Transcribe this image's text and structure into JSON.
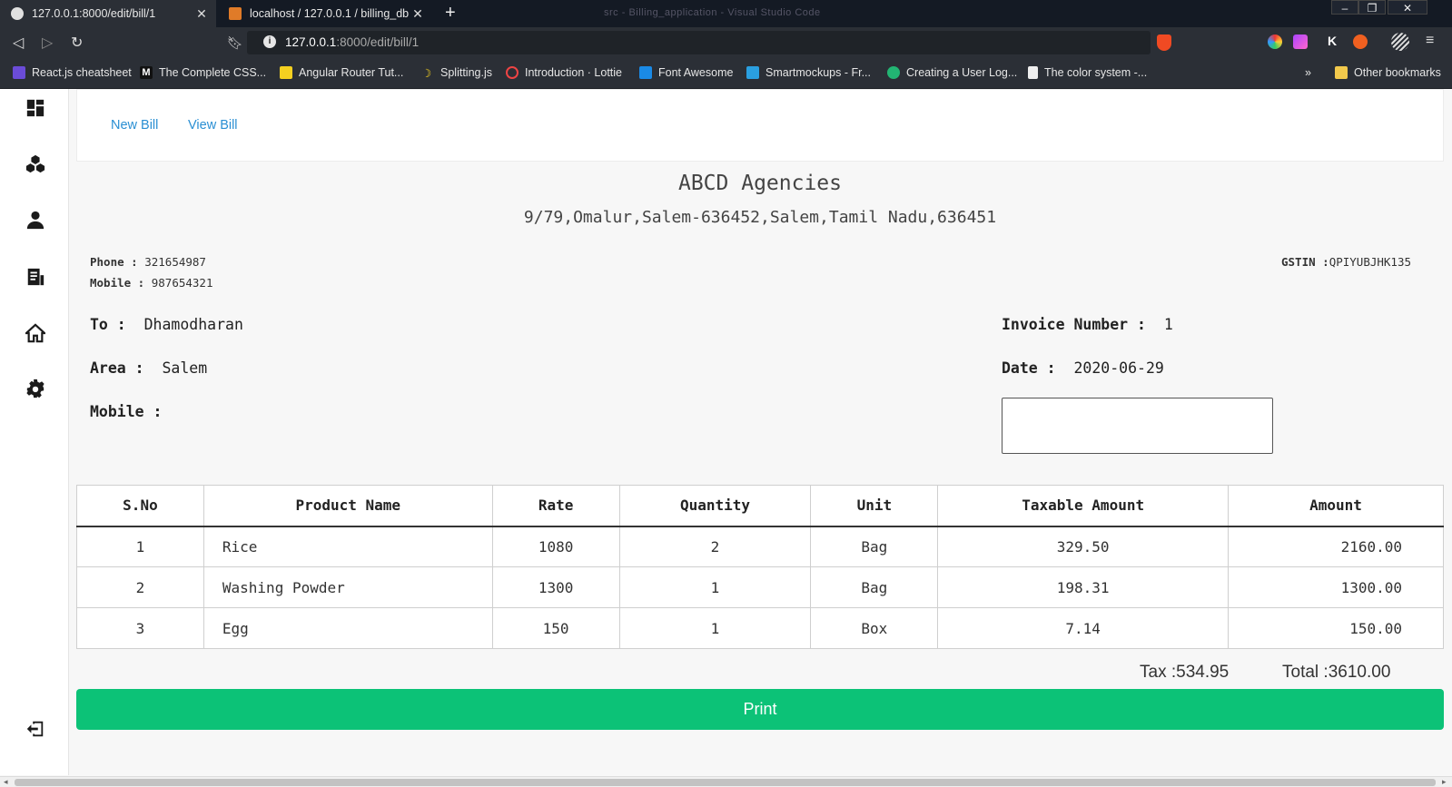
{
  "browser": {
    "tabs": [
      {
        "title": "127.0.0.1:8000/edit/bill/1",
        "active": true
      },
      {
        "title": "localhost / 127.0.0.1 / billing_db / ...",
        "active": false
      }
    ],
    "window_title": "src - Billing_application - Visual Studio Code",
    "url_host": "127.0.0.1",
    "url_rest": ":8000/edit/bill/1",
    "bookmarks": [
      "React.js cheatsheet",
      "The Complete CSS...",
      "Angular Router Tut...",
      "Splitting.js",
      "Introduction · Lottie",
      "Font Awesome",
      "Smartmockups - Fr...",
      "Creating a User Log...",
      "The color system -..."
    ],
    "bookmarks_more": "»",
    "other_bookmarks": "Other bookmarks"
  },
  "nav": {
    "new_bill": "New Bill",
    "view_bill": "View Bill"
  },
  "bill": {
    "company": "ABCD Agencies",
    "address": "9/79,Omalur,Salem-636452,Salem,Tamil Nadu,636451",
    "phone_label": "Phone :",
    "phone": "321654987",
    "mobile_label": "Mobile :",
    "mobile": "987654321",
    "gstin_label": "GSTIN :",
    "gstin": "QPIYUBJHK135",
    "to_label": "To :",
    "to": "Dhamodharan",
    "area_label": "Area :",
    "area": "Salem",
    "cust_mobile_label": "Mobile :",
    "cust_mobile": "",
    "invoice_label": "Invoice Number :",
    "invoice": "1",
    "date_label": "Date :",
    "date": "2020-06-29",
    "notes_value": ""
  },
  "table": {
    "headers": [
      "S.No",
      "Product Name",
      "Rate",
      "Quantity",
      "Unit",
      "Taxable Amount",
      "Amount"
    ],
    "rows": [
      [
        "1",
        "Rice",
        "1080",
        "2",
        "Bag",
        "329.50",
        "2160.00"
      ],
      [
        "2",
        "Washing Powder",
        "1300",
        "1",
        "Bag",
        "198.31",
        "1300.00"
      ],
      [
        "3",
        "Egg",
        "150",
        "1",
        "Box",
        "7.14",
        "150.00"
      ]
    ]
  },
  "totals": {
    "tax_label": "Tax :",
    "tax": "534.95",
    "total_label": "Total :",
    "total": "3610.00"
  },
  "print_label": "Print",
  "colors": {
    "link": "#2a8fd3",
    "print_button": "#0cc277",
    "chrome_dark": "#2b2f36"
  }
}
